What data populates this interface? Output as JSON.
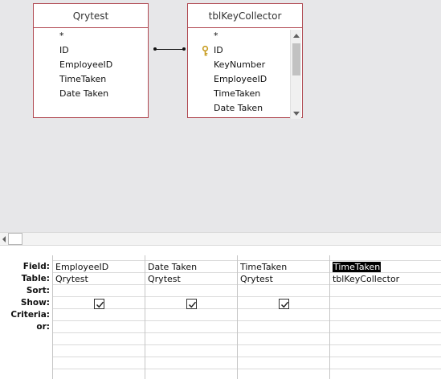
{
  "tables": [
    {
      "name": "Qrytest",
      "fields": [
        "*",
        "ID",
        "EmployeeID",
        "TimeTaken",
        "Date Taken"
      ]
    },
    {
      "name": "tblKeyCollector",
      "fields": [
        "*",
        "ID",
        "KeyNumber",
        "EmployeeID",
        "TimeTaken",
        "Date Taken"
      ],
      "primary_key": "ID"
    }
  ],
  "grid": {
    "row_labels": [
      "Field:",
      "Table:",
      "Sort:",
      "Show:",
      "Criteria:",
      "or:"
    ],
    "columns": [
      {
        "field": "EmployeeID",
        "table": "Qrytest",
        "show": true
      },
      {
        "field": "Date Taken",
        "table": "Qrytest",
        "show": true
      },
      {
        "field": "TimeTaken",
        "table": "Qrytest",
        "show": true
      },
      {
        "field": "TimeTaken",
        "table": "tblKeyCollector",
        "show": false,
        "selected": true
      }
    ]
  },
  "colors": {
    "table_border": "#b04750",
    "pane_background": "#e7e7e9",
    "selection": "#000000"
  }
}
